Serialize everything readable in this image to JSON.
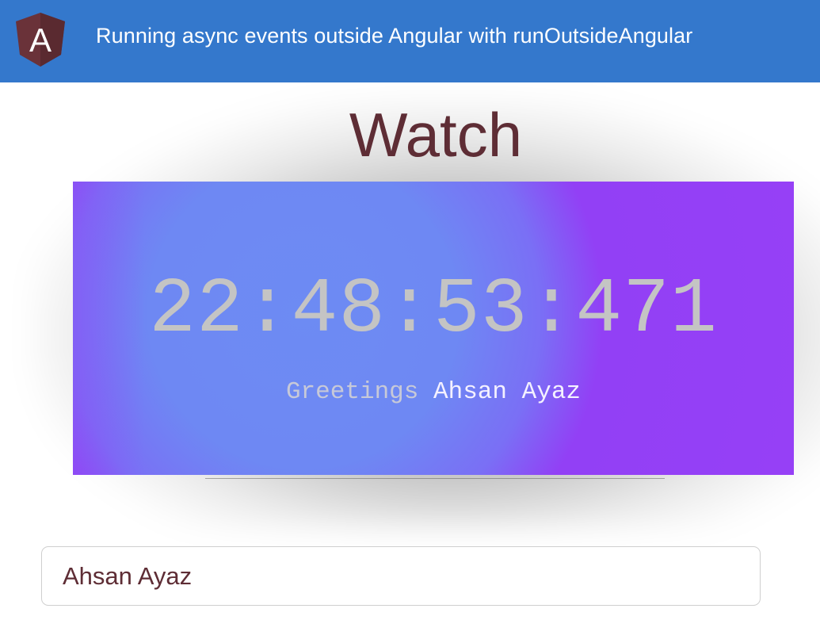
{
  "header": {
    "title": "Running async events outside Angular with runOutsideAngular",
    "logo_letter": "A",
    "background_color": "#3478cc",
    "logo_icon": "angular-shield-icon"
  },
  "page": {
    "title": "Watch",
    "title_color": "#5e2d35"
  },
  "watch": {
    "time": "22:48:53:471",
    "greeting_word": "Greetings",
    "greeting_name": "Ahsan Ayaz",
    "gradient_colors": [
      "#6e88f3",
      "#9640f6"
    ]
  },
  "name_input": {
    "value": "Ahsan Ayaz"
  }
}
